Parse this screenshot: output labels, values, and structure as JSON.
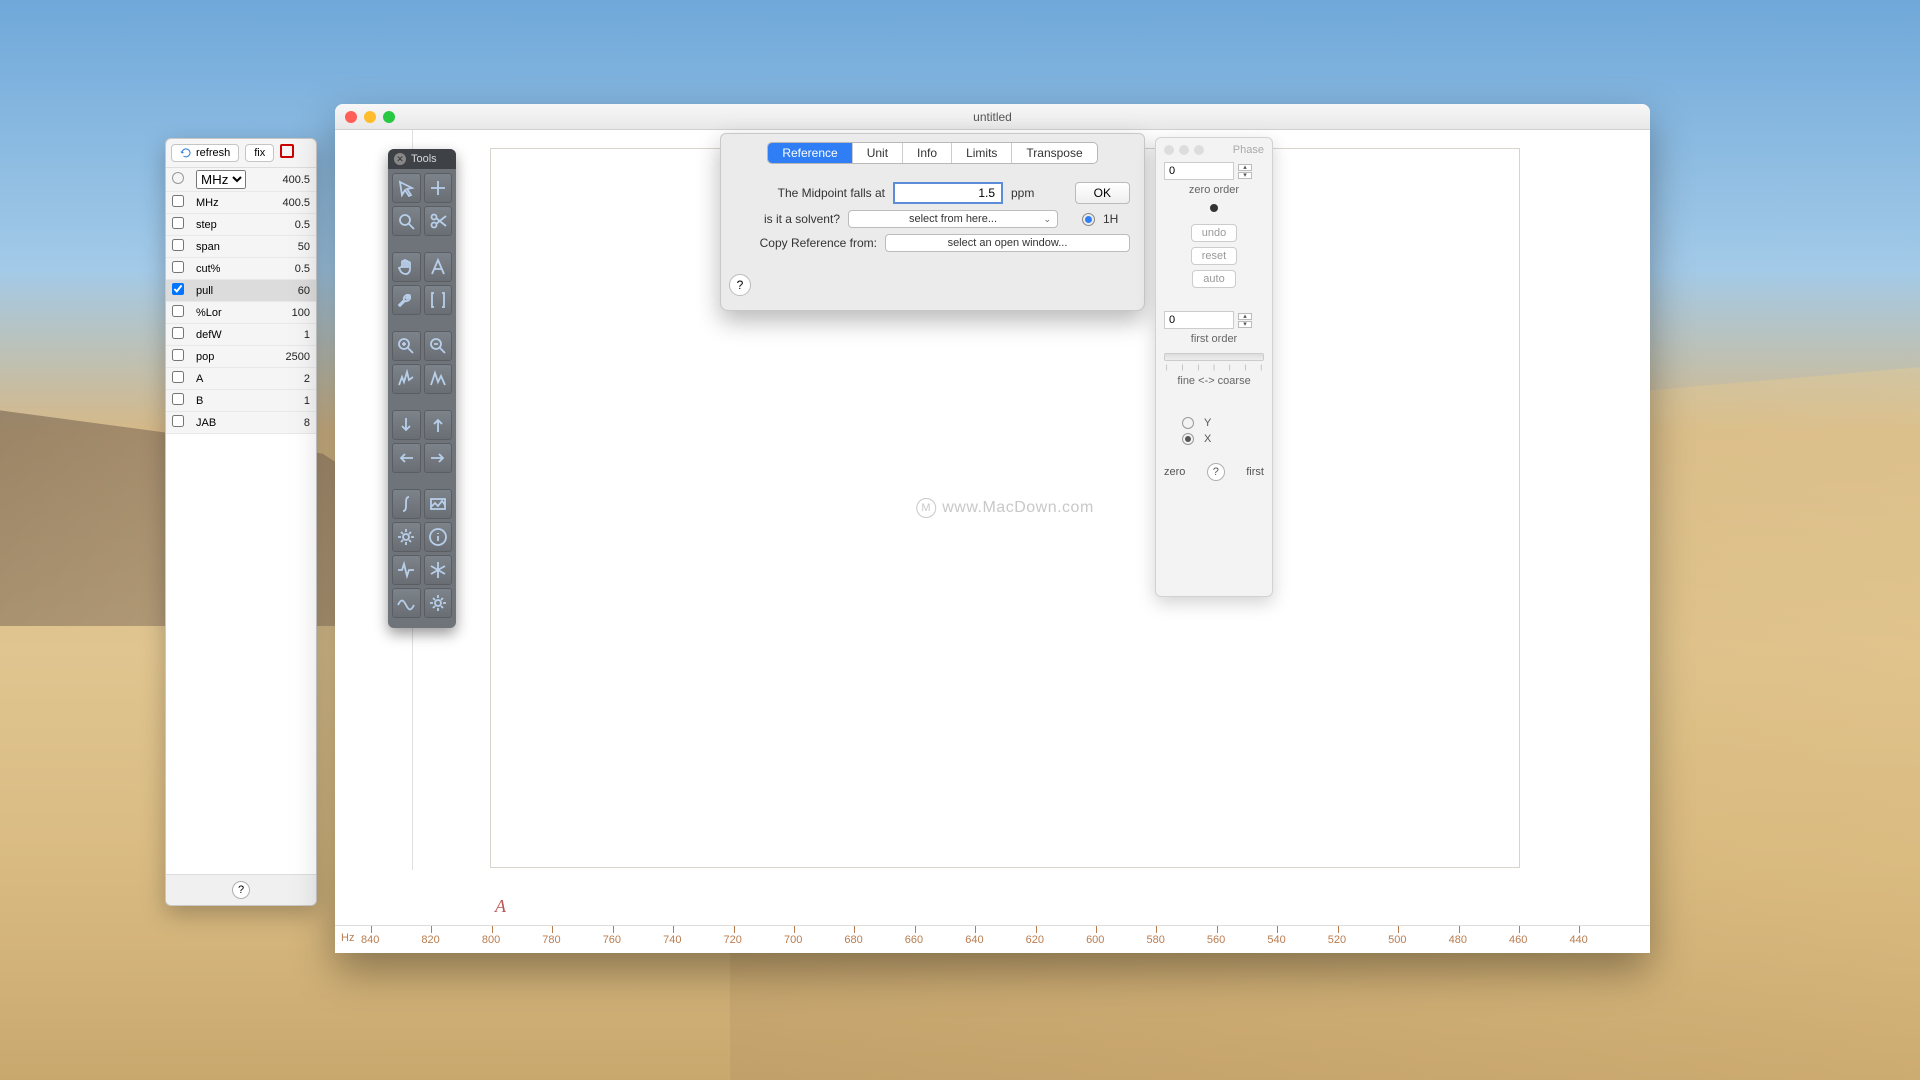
{
  "settings": {
    "refresh": "refresh",
    "fix": "fix",
    "mhz_unit": "MHz",
    "mhz_top": "400.5",
    "rows": [
      {
        "label": "MHz",
        "value": "400.5",
        "checked": false,
        "selected": false
      },
      {
        "label": "step",
        "value": "0.5",
        "checked": false,
        "selected": false
      },
      {
        "label": "span",
        "value": "50",
        "checked": false,
        "selected": false
      },
      {
        "label": "cut%",
        "value": "0.5",
        "checked": false,
        "selected": false
      },
      {
        "label": "pull",
        "value": "60",
        "checked": true,
        "selected": true
      },
      {
        "label": "%Lor",
        "value": "100",
        "checked": false,
        "selected": false
      },
      {
        "label": "defW",
        "value": "1",
        "checked": false,
        "selected": false
      },
      {
        "label": "pop",
        "value": "2500",
        "checked": false,
        "selected": false
      },
      {
        "label": "A",
        "value": "2",
        "checked": false,
        "selected": false
      },
      {
        "label": "B",
        "value": "1",
        "checked": false,
        "selected": false
      },
      {
        "label": "JAB",
        "value": "8",
        "checked": false,
        "selected": false
      }
    ],
    "help": "?"
  },
  "tools_palette": {
    "title": "Tools",
    "tools": [
      "arrow-nw",
      "plus",
      "search",
      "scissors",
      "hand",
      "letter-a",
      "wrench",
      "brackets",
      "zoom-in",
      "zoom-out",
      "peaks-a",
      "peaks-b",
      "arrow-down",
      "arrow-up",
      "arrow-left",
      "arrow-right",
      "integral",
      "landscape",
      "gear-small",
      "info",
      "pulse",
      "snow",
      "wave",
      "gear"
    ]
  },
  "doc": {
    "title": "untitled",
    "watermark": "www.MacDown.com",
    "watermark_badge": "M",
    "a_label": "A",
    "ruler_unit": "Hz",
    "ruler_ticks": [
      "840",
      "820",
      "800",
      "780",
      "760",
      "740",
      "720",
      "700",
      "680",
      "660",
      "640",
      "620",
      "600",
      "580",
      "560",
      "540",
      "520",
      "500",
      "480",
      "460",
      "440"
    ]
  },
  "ref_dialog": {
    "tabs": [
      "Reference",
      "Unit",
      "Info",
      "Limits",
      "Transpose"
    ],
    "active_tab": 0,
    "midpoint_label": "The Midpoint falls at",
    "midpoint_value": "1.5",
    "midpoint_unit": "ppm",
    "ok": "OK",
    "solvent_label": "is it a solvent?",
    "solvent_select": "select from here...",
    "nucleus": "1H",
    "copy_label": "Copy Reference from:",
    "copy_select": "select an open window...",
    "help": "?"
  },
  "phase": {
    "title": "Phase",
    "zero_value": "0",
    "zero_label": "zero order",
    "undo": "undo",
    "reset": "reset",
    "auto": "auto",
    "first_value": "0",
    "first_label": "first order",
    "fine_coarse": "fine <-> coarse",
    "axis_y": "Y",
    "axis_x": "X",
    "foot_zero": "zero",
    "foot_help": "?",
    "foot_first": "first"
  }
}
